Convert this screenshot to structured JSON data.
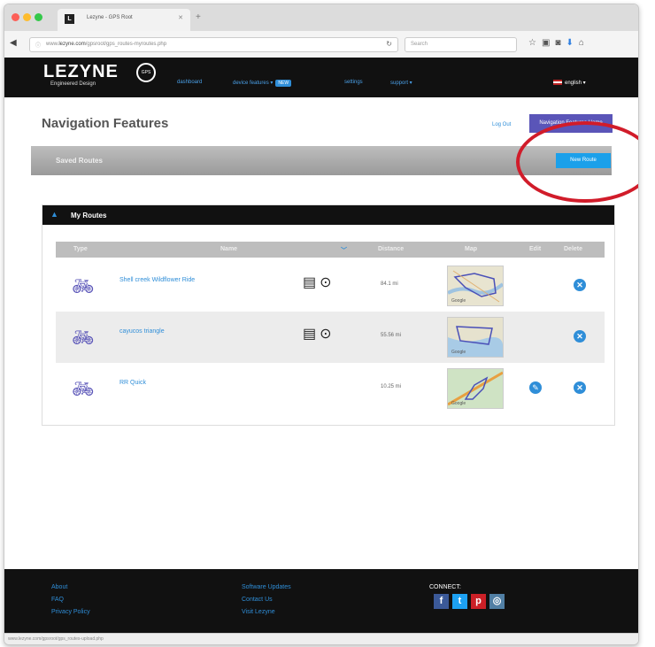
{
  "browser": {
    "tab_title": "Lezyne - GPS Root",
    "url_prefix": "www.",
    "url_domain": "lezyne.com",
    "url_rest": "/gpsroot/gps_routes-myroutes.php",
    "search_placeholder": "Search"
  },
  "site": {
    "logo": "LEZYNE",
    "tagline": "Engineered Design",
    "gps_badge": "GPS",
    "nav": {
      "dashboard": "dashboard",
      "device_features": "device features",
      "device_features_badge": "NEW",
      "settings": "settings",
      "support": "support",
      "language": "english"
    }
  },
  "page": {
    "title": "Navigation Features",
    "logout": "Log Out",
    "purple_button": "Navigation Features Home",
    "section_label": "Saved Routes",
    "new_route_button": "New Route"
  },
  "routes": {
    "header": "My Routes",
    "columns": {
      "type": "Type",
      "name": "Name",
      "distance": "Distance",
      "map": "Map",
      "edit": "Edit",
      "delete": "Delete"
    },
    "items": [
      {
        "name": "Shell creek Wildflower Ride",
        "distance": "84.1 mi",
        "has_actions": true,
        "editable": false
      },
      {
        "name": "cayucos triangle",
        "distance": "55.56 mi",
        "has_actions": true,
        "editable": false
      },
      {
        "name": "RR Quick",
        "distance": "10.25 mi",
        "has_actions": false,
        "editable": true
      }
    ]
  },
  "footer": {
    "about": "About",
    "faq": "FAQ",
    "privacy": "Privacy Policy",
    "software": "Software Updates",
    "contact": "Contact Us",
    "visit": "Visit Lezyne",
    "connect": "CONNECT:"
  },
  "statusbar": "www.lezyne.com/gpsroot/gps_routes-upload.php",
  "colors": {
    "accent": "#2f8ed8",
    "purple": "#5a55b8",
    "highlight_circle": "#d11c2a"
  }
}
